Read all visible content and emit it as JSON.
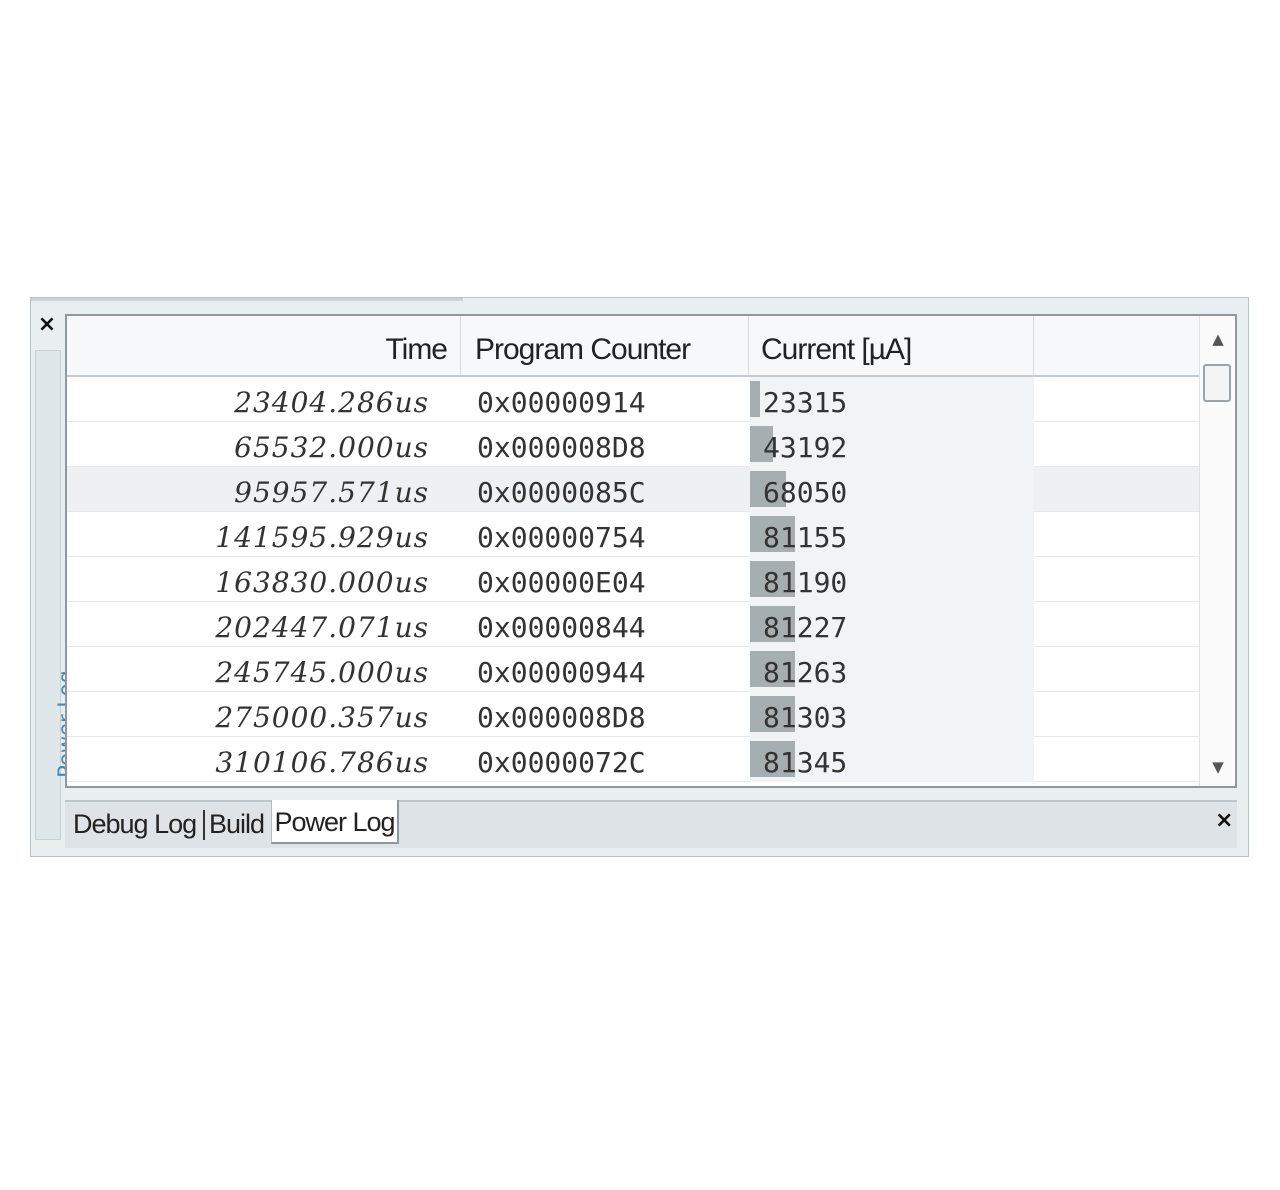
{
  "panel": {
    "title": "Power Log",
    "close_icon": "×"
  },
  "grid": {
    "columns": [
      "Time",
      "Program Counter",
      "Current [µA]"
    ],
    "rows": [
      {
        "time": "23404.286us",
        "pc": "0x00000914",
        "current": "23315",
        "bar": 0.035
      },
      {
        "time": "65532.000us",
        "pc": "0x000008D8",
        "current": "43192",
        "bar": 0.08
      },
      {
        "time": "95957.571us",
        "pc": "0x0000085C",
        "current": "68050",
        "bar": 0.125,
        "selected": true
      },
      {
        "time": "141595.929us",
        "pc": "0x00000754",
        "current": "81155",
        "bar": 0.16
      },
      {
        "time": "163830.000us",
        "pc": "0x00000E04",
        "current": "81190",
        "bar": 0.16
      },
      {
        "time": "202447.071us",
        "pc": "0x00000844",
        "current": "81227",
        "bar": 0.16
      },
      {
        "time": "245745.000us",
        "pc": "0x00000944",
        "current": "81263",
        "bar": 0.16
      },
      {
        "time": "275000.357us",
        "pc": "0x000008D8",
        "current": "81303",
        "bar": 0.16
      },
      {
        "time": "310106.786us",
        "pc": "0x0000072C",
        "current": "81345",
        "bar": 0.16
      }
    ]
  },
  "tabs": {
    "debug_log": "Debug Log",
    "build": "Build",
    "power_log": "Power Log",
    "active": "Power Log"
  },
  "icons": {
    "scroll_up": "chevron-up-icon",
    "scroll_down": "chevron-down-icon",
    "close": "close-icon"
  },
  "colors": {
    "side_title": "#4a88b5",
    "current_bar": "#a7aeb1"
  }
}
